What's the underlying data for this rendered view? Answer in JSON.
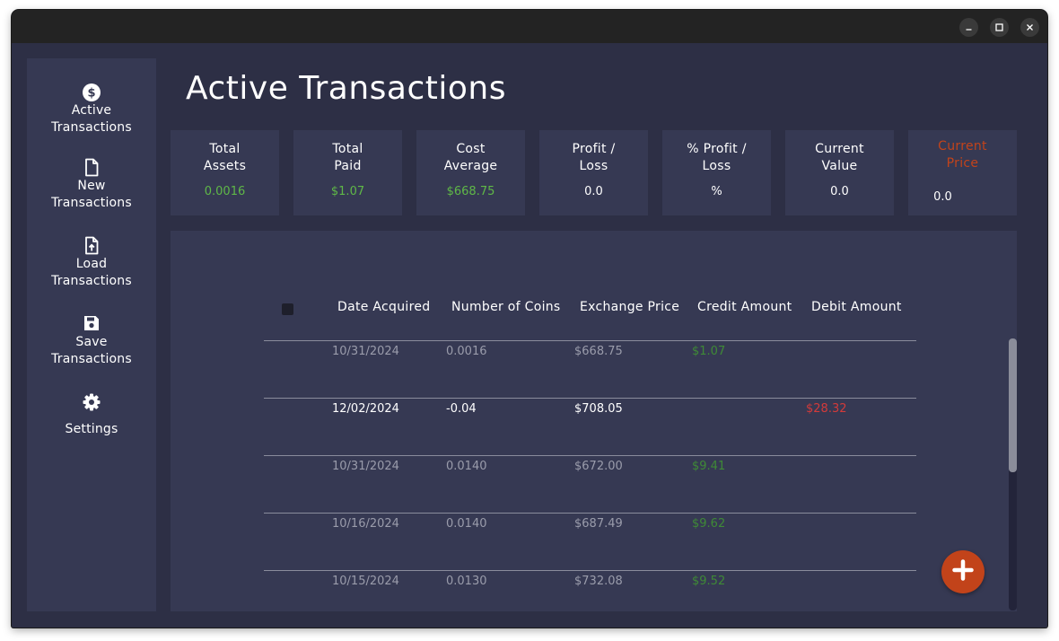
{
  "colors": {
    "window_bg": "#2d2f45",
    "panel_bg": "#363953",
    "titlebar_bg": "#232323",
    "text_primary": "#ffffff",
    "text_muted": "#9a9cab",
    "value_green": "#5fb847",
    "credit_green": "#3f8a36",
    "debit_red": "#d33a3a",
    "accent_orange": "#c2431a"
  },
  "sidebar": {
    "items": [
      {
        "label": "Active\nTransactions",
        "icon": "dollar-circle-icon"
      },
      {
        "label": "New\nTransactions",
        "icon": "file-icon"
      },
      {
        "label": "Load\nTransactions",
        "icon": "file-upload-icon"
      },
      {
        "label": "Save\nTransactions",
        "icon": "save-icon"
      },
      {
        "label": "Settings",
        "icon": "gear-icon"
      }
    ]
  },
  "page": {
    "title": "Active Transactions"
  },
  "summary": [
    {
      "title": "Total\nAssets",
      "value": "0.0016",
      "color": "#5fb847"
    },
    {
      "title": "Total\nPaid",
      "value": "$1.07",
      "color": "#5fb847"
    },
    {
      "title": "Cost\nAverage",
      "value": "$668.75",
      "color": "#5fb847"
    },
    {
      "title": "Profit /\nLoss",
      "value": "0.0",
      "color": "#ffffff"
    },
    {
      "title": "% Profit /\nLoss",
      "value": "%",
      "color": "#ffffff"
    },
    {
      "title": "Current\nValue",
      "value": "0.0",
      "color": "#ffffff"
    },
    {
      "title": "Current\nPrice",
      "value": "0.0",
      "color": "#ffffff",
      "title_color": "#c2431a"
    }
  ],
  "table": {
    "headers": [
      "Date Acquired",
      "Number of Coins",
      "Exchange Price",
      "Credit Amount",
      "Debit Amount"
    ],
    "rows": [
      {
        "date": "10/31/2024",
        "coins": "0.0016",
        "price": "$668.75",
        "credit": "$1.07",
        "debit": "",
        "highlighted": false
      },
      {
        "date": "12/02/2024",
        "coins": "-0.04",
        "price": "$708.05",
        "credit": "",
        "debit": "$28.32",
        "highlighted": true
      },
      {
        "date": "10/31/2024",
        "coins": "0.0140",
        "price": "$672.00",
        "credit": "$9.41",
        "debit": "",
        "highlighted": false
      },
      {
        "date": "10/16/2024",
        "coins": "0.0140",
        "price": "$687.49",
        "credit": "$9.62",
        "debit": "",
        "highlighted": false
      },
      {
        "date": "10/15/2024",
        "coins": "0.0130",
        "price": "$732.08",
        "credit": "$9.52",
        "debit": "",
        "highlighted": false
      }
    ]
  },
  "window_controls": [
    "minimize-icon",
    "maximize-icon",
    "close-icon"
  ],
  "fab": {
    "icon": "plus-icon"
  }
}
